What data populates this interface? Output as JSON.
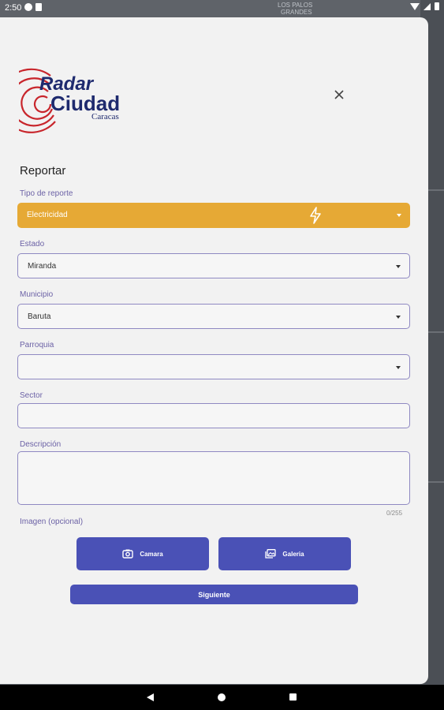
{
  "status_bar": {
    "time": "2:50"
  },
  "map": {
    "top_text_1": "LOS PALOS",
    "top_text_2": "GRANDES"
  },
  "header": {
    "close_icon": "close-icon"
  },
  "form": {
    "title": "Reportar",
    "tipo": {
      "label": "Tipo de reporte",
      "value": "Electricidad",
      "icon": "lightning-icon",
      "color": "#E6A935"
    },
    "estado": {
      "label": "Estado",
      "value": "Miranda"
    },
    "municipio": {
      "label": "Municipio",
      "value": "Baruta"
    },
    "parroquia": {
      "label": "Parroquia",
      "value": ""
    },
    "sector": {
      "label": "Sector",
      "value": ""
    },
    "descripcion": {
      "label": "Descripción",
      "value": "",
      "counter": "0/255"
    },
    "imagen": {
      "label": "Imagen (opcional)"
    }
  },
  "buttons": {
    "camara": "Camara",
    "galeria": "Galeria",
    "siguiente": "Siguiente",
    "accent": "#4A51B6"
  }
}
